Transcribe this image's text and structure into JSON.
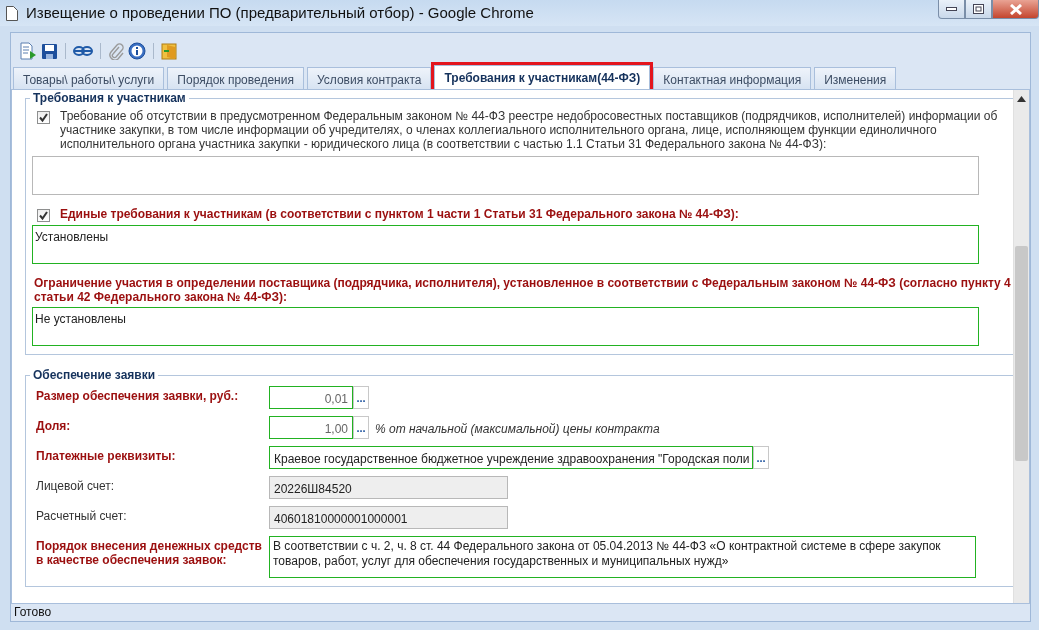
{
  "window": {
    "title": "Извещение о проведении ПО (предварительный отбор) - Google Chrome"
  },
  "tabs": [
    {
      "label": "Товары\\ работы\\ услуги",
      "selected": false,
      "highlighted": false
    },
    {
      "label": "Порядок проведения",
      "selected": false,
      "highlighted": false
    },
    {
      "label": "Условия контракта",
      "selected": false,
      "highlighted": false
    },
    {
      "label": "Требования к участникам(44-ФЗ)",
      "selected": true,
      "highlighted": true
    },
    {
      "label": "Контактная информация",
      "selected": false,
      "highlighted": false
    },
    {
      "label": "Изменения",
      "selected": false,
      "highlighted": false
    }
  ],
  "requirements": {
    "title": "Требования к участникам",
    "items": [
      {
        "kind": "checkbox",
        "checked": true,
        "required": false,
        "label": "Требование об отсутствии в предусмотренном Федеральным законом № 44-ФЗ реестре недобросовестных поставщиков (подрядчиков, исполнителей) информации об участнике закупки, в том числе информации об учредителях, о членах коллегиального исполнительного органа, лице, исполняющем функции единоличного исполнительного органа участника закупки - юридического лица (в соответствии с частью 1.1 Статьи 31 Федерального закона № 44-ФЗ):"
      },
      {
        "kind": "checkbox",
        "checked": true,
        "required": true,
        "label": "Единые требования к участникам (в соответствии с пунктом 1 части 1 Статьи 31 Федерального закона № 44-ФЗ):",
        "value": "Установлены"
      },
      {
        "kind": "plain",
        "required": true,
        "label": "Ограничение участия в определении поставщика (подрядчика, исполнителя), установленное в соответствии с Федеральным законом № 44-ФЗ (согласно пункту 4 статьи 42 Федерального закона № 44-ФЗ):",
        "value": "Не установлены"
      }
    ]
  },
  "security": {
    "title": "Обеспечение заявки",
    "fields": [
      {
        "kind": "number",
        "required": true,
        "label": "Размер обеспечения заявки, руб.:",
        "value": "0,01",
        "button": "..."
      },
      {
        "kind": "number",
        "required": true,
        "label": "Доля:",
        "value": "1,00",
        "button": "...",
        "suffix": "% от начальной (максимальной) цены контракта"
      },
      {
        "kind": "lookup",
        "required": true,
        "label": "Платежные реквизиты:",
        "value": "Краевое государственное бюджетное учреждение здравоохранения \"Городская поли",
        "button": "..."
      },
      {
        "kind": "readonly",
        "required": false,
        "label": "Лицевой счет:",
        "value": "20226Ш84520"
      },
      {
        "kind": "readonly",
        "required": false,
        "label": "Расчетный счет:",
        "value": "40601810000001000001"
      },
      {
        "kind": "textarea",
        "required": true,
        "label": "Порядок внесения денежных средств в качестве обеспечения заявок:",
        "value": "В соответствии с ч. 2, ч. 8 ст. 44 Федерального закона от 05.04.2013 № 44-ФЗ «О контрактной системе в сфере закупок товаров, работ, услуг для обеспечения государственных и муниципальных нужд»"
      }
    ]
  },
  "status_bar": "Готово"
}
